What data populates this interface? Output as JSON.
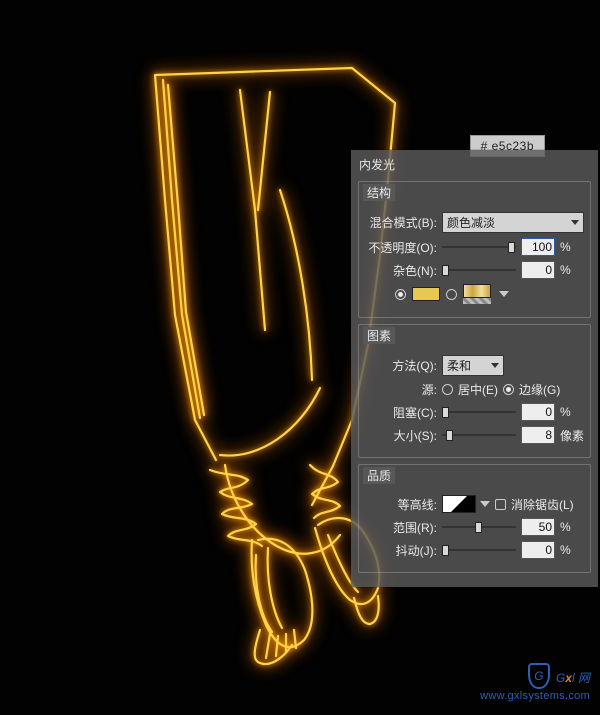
{
  "hex_label": "#  e5c23b",
  "panel": {
    "title": "内发光",
    "structure": {
      "legend": "结构",
      "blend_label": "混合模式(B):",
      "blend_value": "颜色减淡",
      "opacity_label": "不透明度(O):",
      "opacity_value": "100",
      "opacity_unit": "%",
      "noise_label": "杂色(N):",
      "noise_value": "0",
      "noise_unit": "%",
      "color_hex": "#e5c23b"
    },
    "elements": {
      "legend": "图素",
      "method_label": "方法(Q):",
      "method_value": "柔和",
      "source_label": "源:",
      "source_center": "居中(E)",
      "source_edge": "边缘(G)",
      "source_selected": "edge",
      "choke_label": "阻塞(C):",
      "choke_value": "0",
      "choke_unit": "%",
      "size_label": "大小(S):",
      "size_value": "8",
      "size_unit": "像素"
    },
    "quality": {
      "legend": "品质",
      "contour_label": "等高线:",
      "antialias_label": "消除锯齿(L)",
      "antialias_checked": false,
      "range_label": "范围(R):",
      "range_value": "50",
      "range_unit": "%",
      "jitter_label": "抖动(J):",
      "jitter_value": "0",
      "jitter_unit": "%"
    }
  },
  "watermark": {
    "brand_prefix": "G",
    "brand_accent": "x",
    "brand_suffix": "l",
    "brand_cn": " 网",
    "url": "www.gxlsystems.com"
  }
}
